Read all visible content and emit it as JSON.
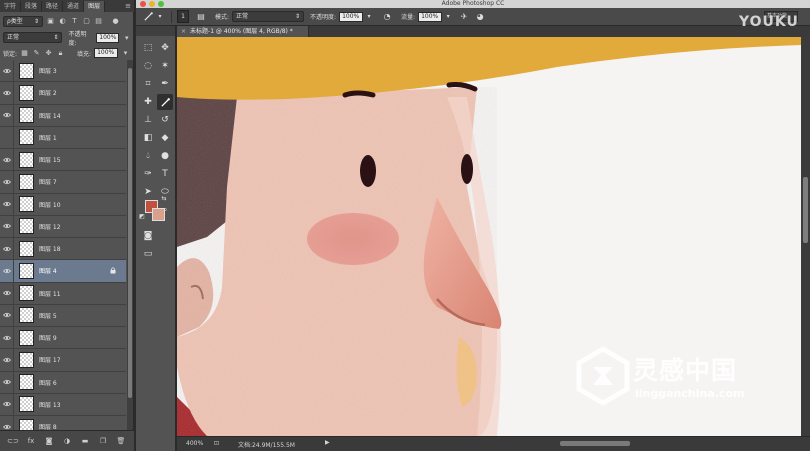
{
  "app_title": "Adobe Photoshop CC",
  "panel_tabs": [
    "字符",
    "段落",
    "路径",
    "通道",
    "图层"
  ],
  "filter": {
    "kind_label": "ρ类型",
    "icons": [
      "image-icon",
      "adjust-icon",
      "text-icon",
      "shape-icon",
      "smart-icon"
    ]
  },
  "blend": {
    "mode": "正常",
    "opacity_label": "不透明度:",
    "opacity_value": "100%"
  },
  "lock": {
    "lock_label": "锁定:",
    "fill_label": "填充:",
    "fill_value": "100%"
  },
  "layers": [
    {
      "name": "图层 3",
      "visible": true,
      "selected": false
    },
    {
      "name": "图层 2",
      "visible": true,
      "selected": false
    },
    {
      "name": "图层 14",
      "visible": true,
      "selected": false
    },
    {
      "name": "图层 1",
      "visible": false,
      "selected": false
    },
    {
      "name": "图层 15",
      "visible": true,
      "selected": false
    },
    {
      "name": "图层 7",
      "visible": true,
      "selected": false
    },
    {
      "name": "图层 10",
      "visible": true,
      "selected": false
    },
    {
      "name": "图层 12",
      "visible": true,
      "selected": false
    },
    {
      "name": "图层 18",
      "visible": true,
      "selected": false
    },
    {
      "name": "图层 4",
      "visible": true,
      "selected": true
    },
    {
      "name": "图层 11",
      "visible": true,
      "selected": false
    },
    {
      "name": "图层 5",
      "visible": true,
      "selected": false
    },
    {
      "name": "图层 9",
      "visible": true,
      "selected": false
    },
    {
      "name": "图层 17",
      "visible": true,
      "selected": false
    },
    {
      "name": "图层 6",
      "visible": true,
      "selected": false
    },
    {
      "name": "图层 13",
      "visible": true,
      "selected": false
    },
    {
      "name": "图层 8",
      "visible": true,
      "selected": false
    }
  ],
  "options_bar": {
    "brush_size": "1",
    "mode_label": "模式:",
    "mode_value": "正常",
    "opacity_label": "不透明度:",
    "opacity_value": "100%",
    "flow_label": "流量:",
    "flow_value": "100%",
    "workspace": "基本功能"
  },
  "document_tab": {
    "title": "未标题-1 @ 400% (图层 4, RGB/8) *"
  },
  "status": {
    "zoom": "400%",
    "doc_size": "文档:24.9M/155.5M"
  },
  "colors": {
    "foreground": "#c0503f",
    "background": "#d9a08b",
    "hat": "#e2a93b",
    "skin": "#f0c7b8",
    "cheek": "#e08f86",
    "eye": "#2a1214"
  },
  "watermarks": {
    "youku": "YOUKU",
    "site_cn": "灵感中国",
    "site_url": "lingganchina.com"
  }
}
